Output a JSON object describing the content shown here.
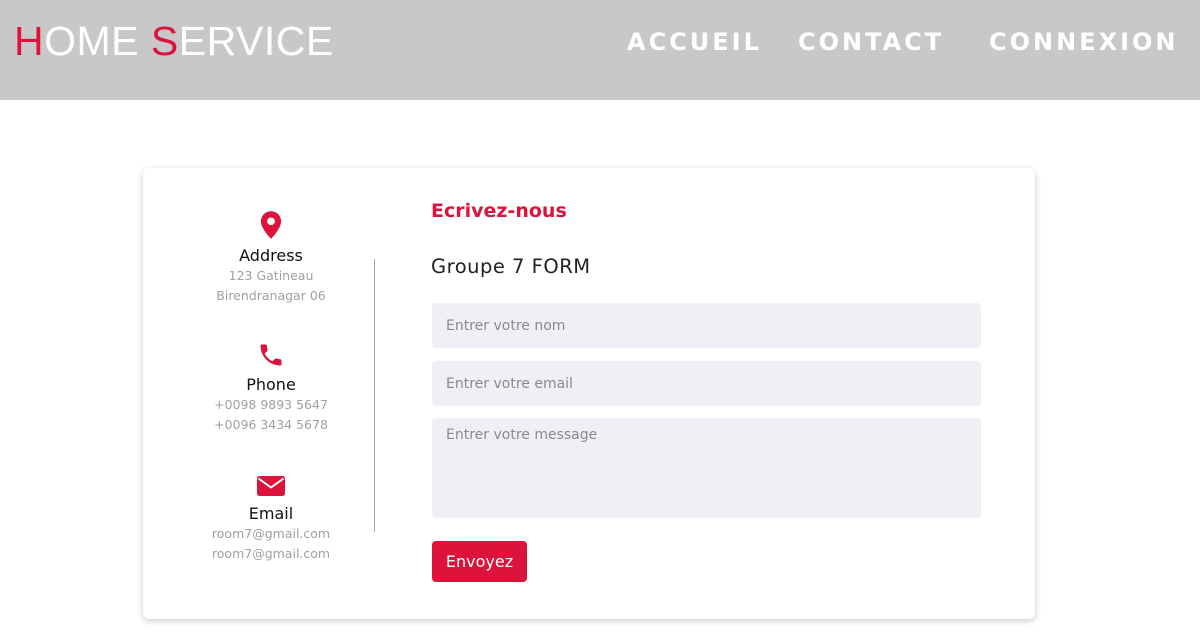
{
  "header": {
    "brand_first_letter": "H",
    "brand_rest1": "OME ",
    "brand_second_letter": "S",
    "brand_rest2": "ERVICE",
    "nav": {
      "accueil": "ACCUEIL",
      "contact": "CONTACT",
      "connexion": "CONNEXION"
    }
  },
  "contact_info": {
    "address": {
      "icon": "map-pin-icon",
      "title": "Address",
      "lines": [
        "123 Gatineau",
        "Birendranagar 06"
      ]
    },
    "phone": {
      "icon": "phone-icon",
      "title": "Phone",
      "lines": [
        "+0098 9893 5647",
        "+0096 3434 5678"
      ]
    },
    "email": {
      "icon": "envelope-icon",
      "title": "Email",
      "lines": [
        "room7@gmail.com",
        "room7@gmail.com"
      ]
    }
  },
  "form": {
    "heading": "Ecrivez-nous",
    "subtitle": "Groupe 7 FORM",
    "name_placeholder": "Entrer votre nom",
    "email_placeholder": "Entrer votre email",
    "message_placeholder": "Entrer votre message",
    "submit_label": "Envoyez"
  },
  "colors": {
    "accent": "#dc143c",
    "navbar_bg": "#c8c8c8",
    "input_bg": "#efeff6",
    "muted_text": "#a0a0a0"
  }
}
